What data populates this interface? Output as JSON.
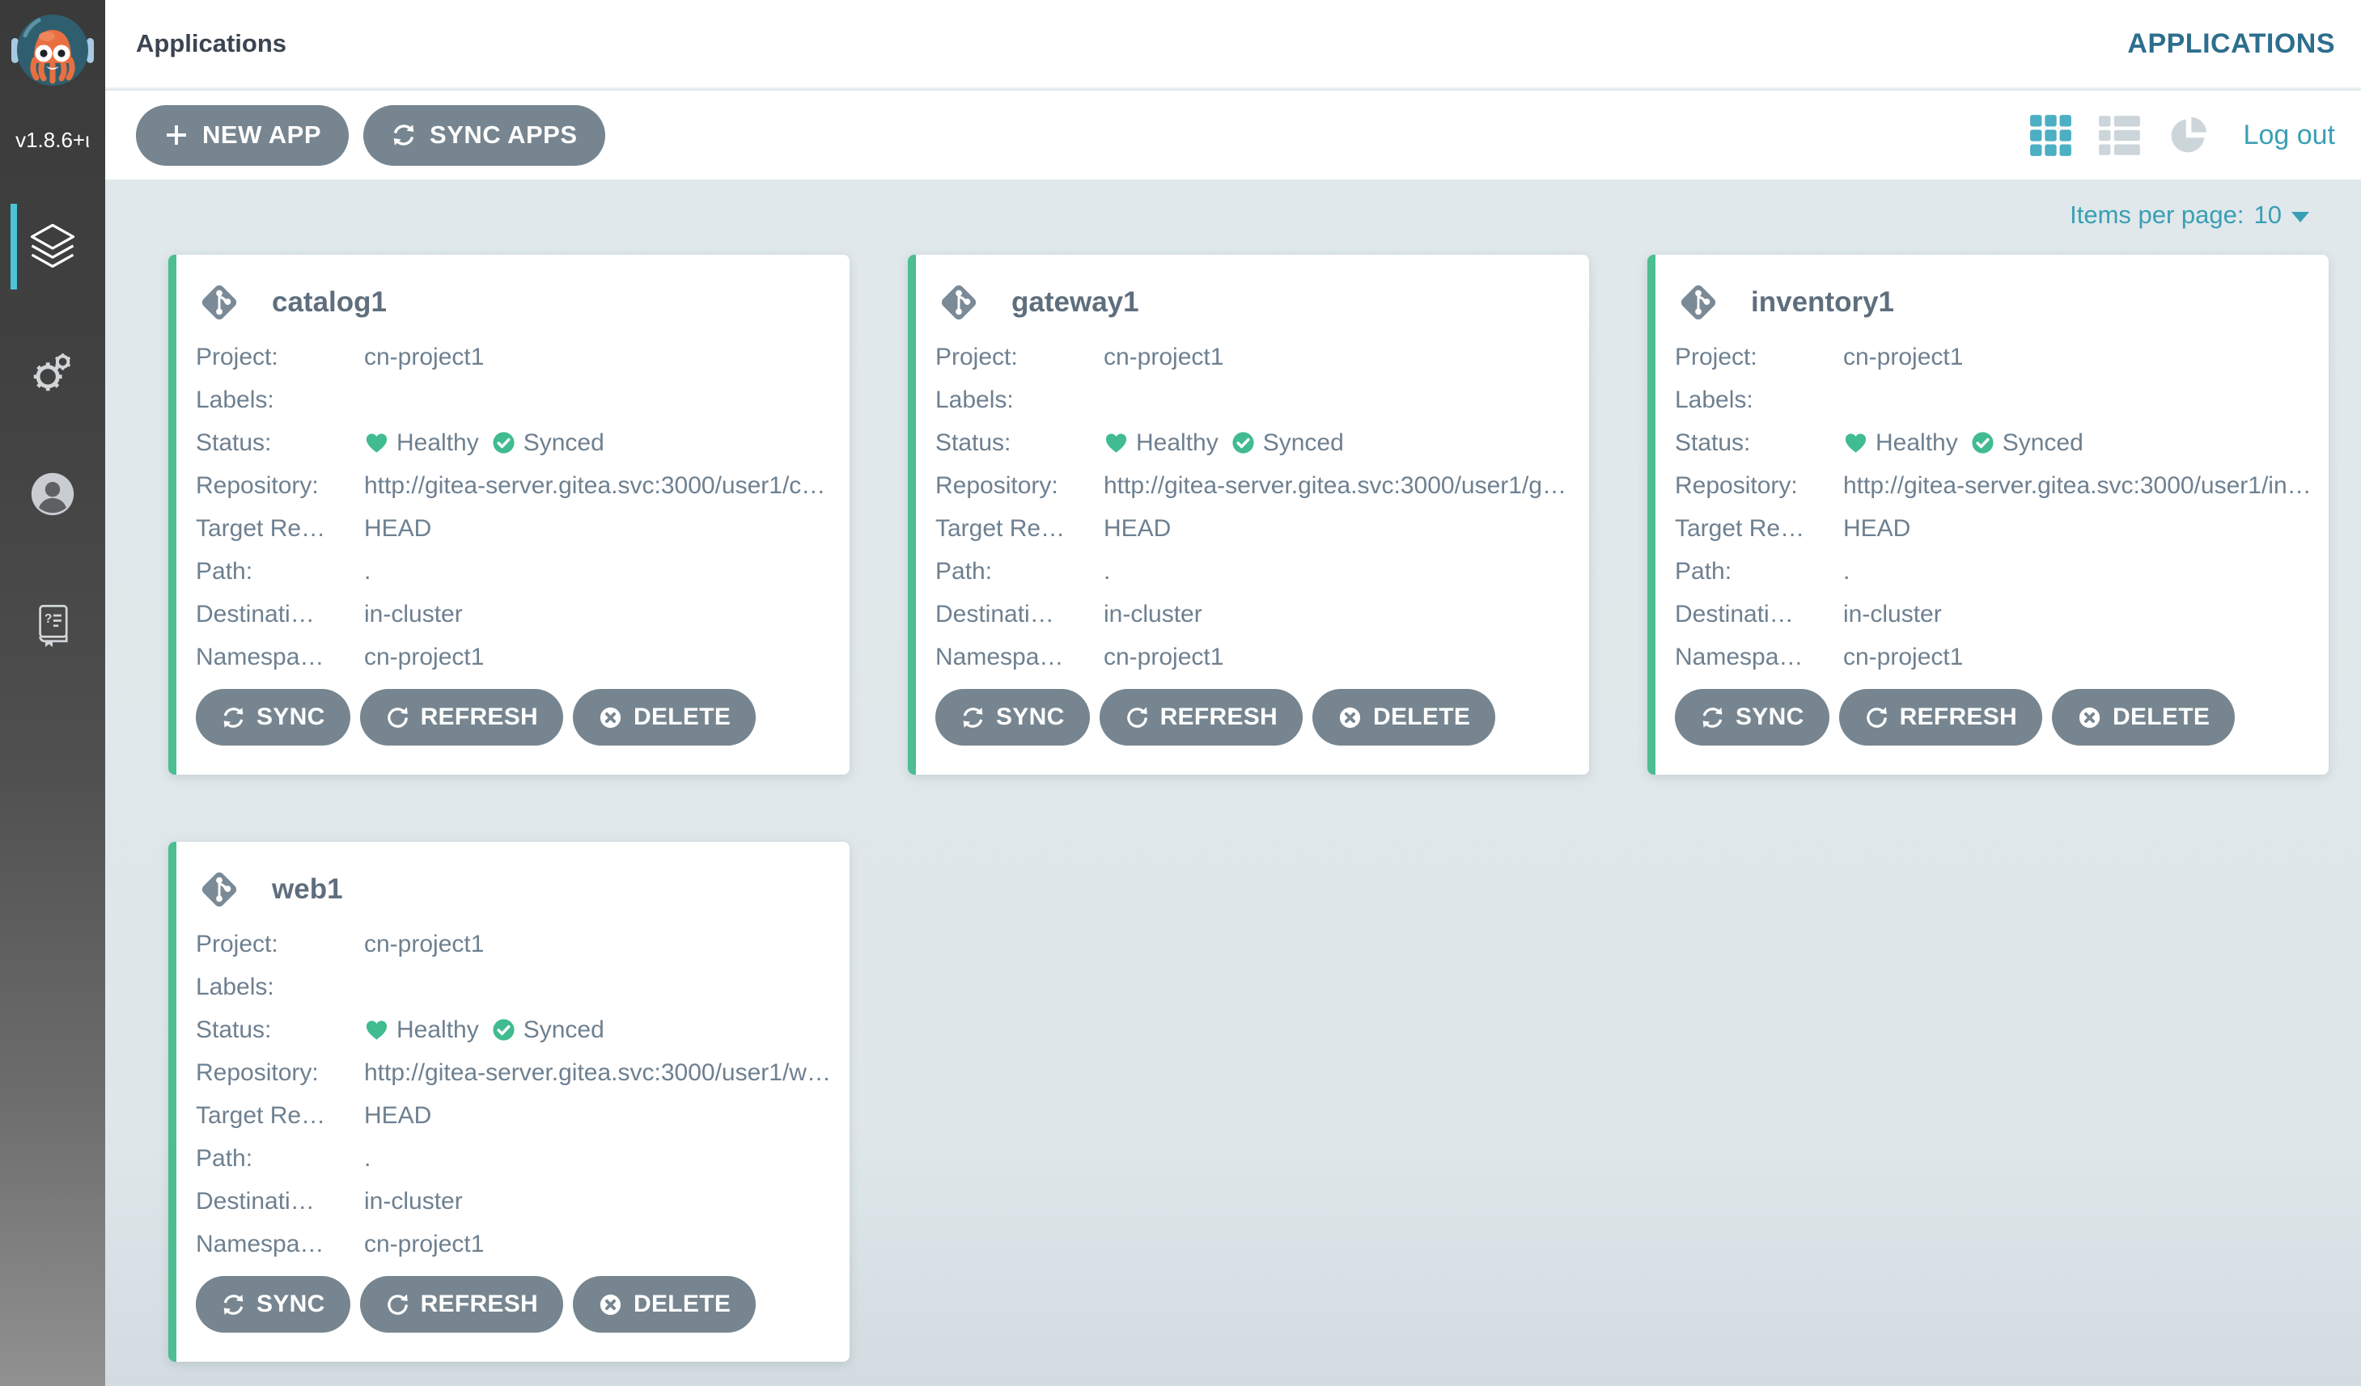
{
  "colors": {
    "accent_teal": "#4cafc3",
    "active_bar_teal": "#4cc3d9",
    "link_teal": "#3aa0b5",
    "section_header": "#2d6e8d",
    "card_accent_green": "#4dbd92",
    "status_green": "#41bb90",
    "button_slate": "#76858f",
    "text_slate": "#6e8090"
  },
  "sidebar": {
    "logo_icon": "argo-octopus-logo",
    "version": "v1.8.6+ι",
    "items": [
      {
        "name": "applications",
        "icon": "layers-icon",
        "active": true
      },
      {
        "name": "settings",
        "icon": "gear-icon",
        "active": false
      },
      {
        "name": "user",
        "icon": "user-icon",
        "active": false
      },
      {
        "name": "help",
        "icon": "docs-icon",
        "active": false
      }
    ]
  },
  "header": {
    "breadcrumb": "Applications",
    "section_label": "APPLICATIONS"
  },
  "toolbar": {
    "buttons": [
      {
        "label": "NEW APP",
        "icon": "plus-icon"
      },
      {
        "label": "SYNC APPS",
        "icon": "sync-icon"
      }
    ],
    "view_toggles": [
      {
        "icon": "grid-icon",
        "active": true
      },
      {
        "icon": "list-icon",
        "active": false
      },
      {
        "icon": "pie-icon",
        "active": false
      }
    ],
    "logout_label": "Log out"
  },
  "pagination": {
    "label": "Items per page:",
    "value": "10",
    "caret_icon": "caret-down-icon"
  },
  "cards": [
    {
      "title": "catalog1",
      "icon": "git-commit-icon",
      "fields": [
        {
          "label": "Project:",
          "value": "cn-project1"
        },
        {
          "label": "Labels:",
          "value": ""
        },
        {
          "label": "Status:",
          "type": "status",
          "health": {
            "icon": "heart-icon",
            "label": "Healthy"
          },
          "sync": {
            "icon": "check-circle-icon",
            "label": "Synced"
          }
        },
        {
          "label": "Repository:",
          "value": "http://gitea-server.gitea.svc:3000/user1/c…"
        },
        {
          "label": "Target Re…",
          "value": "HEAD"
        },
        {
          "label": "Path:",
          "value": "."
        },
        {
          "label": "Destinati…",
          "value": "in-cluster"
        },
        {
          "label": "Namespa…",
          "value": "cn-project1"
        }
      ],
      "actions": [
        {
          "label": "SYNC",
          "icon": "sync-icon"
        },
        {
          "label": "REFRESH",
          "icon": "refresh-icon"
        },
        {
          "label": "DELETE",
          "icon": "delete-icon"
        }
      ]
    },
    {
      "title": "gateway1",
      "icon": "git-commit-icon",
      "fields": [
        {
          "label": "Project:",
          "value": "cn-project1"
        },
        {
          "label": "Labels:",
          "value": ""
        },
        {
          "label": "Status:",
          "type": "status",
          "health": {
            "icon": "heart-icon",
            "label": "Healthy"
          },
          "sync": {
            "icon": "check-circle-icon",
            "label": "Synced"
          }
        },
        {
          "label": "Repository:",
          "value": "http://gitea-server.gitea.svc:3000/user1/g…"
        },
        {
          "label": "Target Re…",
          "value": "HEAD"
        },
        {
          "label": "Path:",
          "value": "."
        },
        {
          "label": "Destinati…",
          "value": "in-cluster"
        },
        {
          "label": "Namespa…",
          "value": "cn-project1"
        }
      ],
      "actions": [
        {
          "label": "SYNC",
          "icon": "sync-icon"
        },
        {
          "label": "REFRESH",
          "icon": "refresh-icon"
        },
        {
          "label": "DELETE",
          "icon": "delete-icon"
        }
      ]
    },
    {
      "title": "inventory1",
      "icon": "git-commit-icon",
      "fields": [
        {
          "label": "Project:",
          "value": "cn-project1"
        },
        {
          "label": "Labels:",
          "value": ""
        },
        {
          "label": "Status:",
          "type": "status",
          "health": {
            "icon": "heart-icon",
            "label": "Healthy"
          },
          "sync": {
            "icon": "check-circle-icon",
            "label": "Synced"
          }
        },
        {
          "label": "Repository:",
          "value": "http://gitea-server.gitea.svc:3000/user1/in…"
        },
        {
          "label": "Target Re…",
          "value": "HEAD"
        },
        {
          "label": "Path:",
          "value": "."
        },
        {
          "label": "Destinati…",
          "value": "in-cluster"
        },
        {
          "label": "Namespa…",
          "value": "cn-project1"
        }
      ],
      "actions": [
        {
          "label": "SYNC",
          "icon": "sync-icon"
        },
        {
          "label": "REFRESH",
          "icon": "refresh-icon"
        },
        {
          "label": "DELETE",
          "icon": "delete-icon"
        }
      ]
    },
    {
      "title": "web1",
      "icon": "git-commit-icon",
      "fields": [
        {
          "label": "Project:",
          "value": "cn-project1"
        },
        {
          "label": "Labels:",
          "value": ""
        },
        {
          "label": "Status:",
          "type": "status",
          "health": {
            "icon": "heart-icon",
            "label": "Healthy"
          },
          "sync": {
            "icon": "check-circle-icon",
            "label": "Synced"
          }
        },
        {
          "label": "Repository:",
          "value": "http://gitea-server.gitea.svc:3000/user1/w…"
        },
        {
          "label": "Target Re…",
          "value": "HEAD"
        },
        {
          "label": "Path:",
          "value": "."
        },
        {
          "label": "Destinati…",
          "value": "in-cluster"
        },
        {
          "label": "Namespa…",
          "value": "cn-project1"
        }
      ],
      "actions": [
        {
          "label": "SYNC",
          "icon": "sync-icon"
        },
        {
          "label": "REFRESH",
          "icon": "refresh-icon"
        },
        {
          "label": "DELETE",
          "icon": "delete-icon"
        }
      ]
    }
  ]
}
